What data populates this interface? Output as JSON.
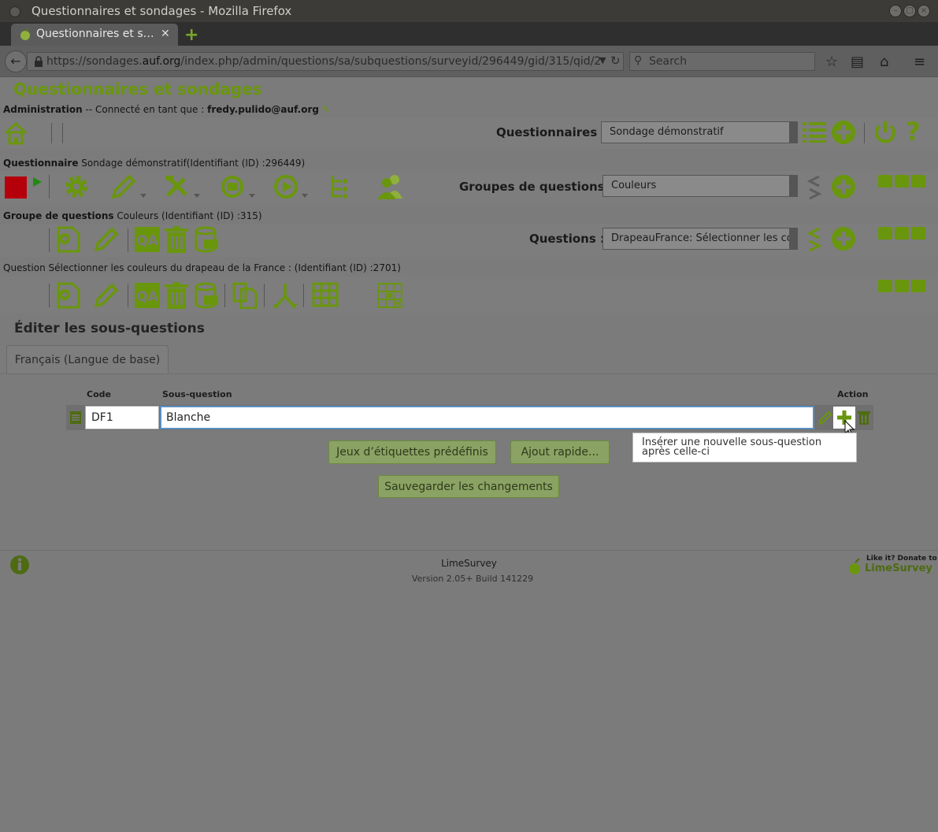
{
  "window": {
    "title": "Questionnaires et sondages - Mozilla Firefox",
    "tab_title": "Questionnaires et s…",
    "url_prefix": "https://sondages.",
    "url_domain": "auf.org",
    "url_suffix": "/index.php/admin/questions/sa/subquestions/surveyid/296449/gid/315/qid/2",
    "search_placeholder": "Search"
  },
  "header": {
    "site_title": "Questionnaires et sondages",
    "admin_label": "Administration",
    "connected_text": "-- Connecté en tant que :",
    "user": "fredy.pulido@auf.org"
  },
  "toolbar_admin": {
    "surveys_label": "Questionnaires :",
    "survey_select": "Sondage démonstratif"
  },
  "toolbar_survey": {
    "label_bold": "Questionnaire",
    "label_rest": " Sondage démonstratif(Identifiant (ID) :296449)",
    "groups_label": "Groupes de questions :",
    "group_select": "Couleurs"
  },
  "toolbar_group": {
    "label_bold": "Groupe de questions",
    "label_rest": "  Couleurs (Identifiant (ID) :315)",
    "questions_label": "Questions :",
    "question_select": "DrapeauFrance: Sélectionner les coul"
  },
  "toolbar_question": {
    "label": "Question Sélectionner les couleurs du drapeau de la France : (Identifiant (ID) :2701)"
  },
  "editor": {
    "heading": "Éditer les sous-questions",
    "language_tab": "Français (Langue de base)",
    "col_code": "Code",
    "col_subquestion": "Sous-question",
    "col_action": "Action",
    "rows": [
      {
        "code": "DF1",
        "text": "Blanche"
      }
    ],
    "tooltip": "Insérer une nouvelle sous-question après celle-ci",
    "predefined_btn": "Jeux d’étiquettes prédéfinis",
    "quick_add_btn": "Ajout rapide...",
    "save_btn": "Sauvegarder les changements"
  },
  "footer": {
    "product": "LimeSurvey",
    "version": "Version 2.05+ Build 141229",
    "donate_top": "Like it? Donate to",
    "donate_brand": "LimeSurvey"
  },
  "colors": {
    "accent_green": "#69960c",
    "overlay_gray": "#7b7b7b"
  }
}
